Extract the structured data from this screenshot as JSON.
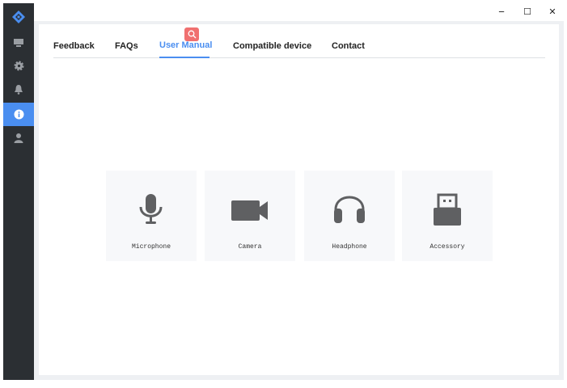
{
  "sidebar": {
    "items": [
      {
        "name": "logo"
      },
      {
        "name": "monitor"
      },
      {
        "name": "settings"
      },
      {
        "name": "notifications"
      },
      {
        "name": "info",
        "active": true
      },
      {
        "name": "user"
      }
    ]
  },
  "window": {
    "minimize": "−",
    "maximize": "☐",
    "close": "✕"
  },
  "tabs": [
    {
      "label": "Feedback"
    },
    {
      "label": "FAQs"
    },
    {
      "label": "User Manual",
      "active": true
    },
    {
      "label": "Compatible device"
    },
    {
      "label": "Contact"
    }
  ],
  "cards": [
    {
      "label": "Microphone",
      "icon": "microphone-icon"
    },
    {
      "label": "Camera",
      "icon": "camera-icon"
    },
    {
      "label": "Headphone",
      "icon": "headphone-icon"
    },
    {
      "label": "Accessory",
      "icon": "usb-icon"
    }
  ],
  "colors": {
    "accent": "#4a8ef0",
    "sidebar": "#2b2f33",
    "badge": "#f07070",
    "icon": "#5f6062"
  }
}
